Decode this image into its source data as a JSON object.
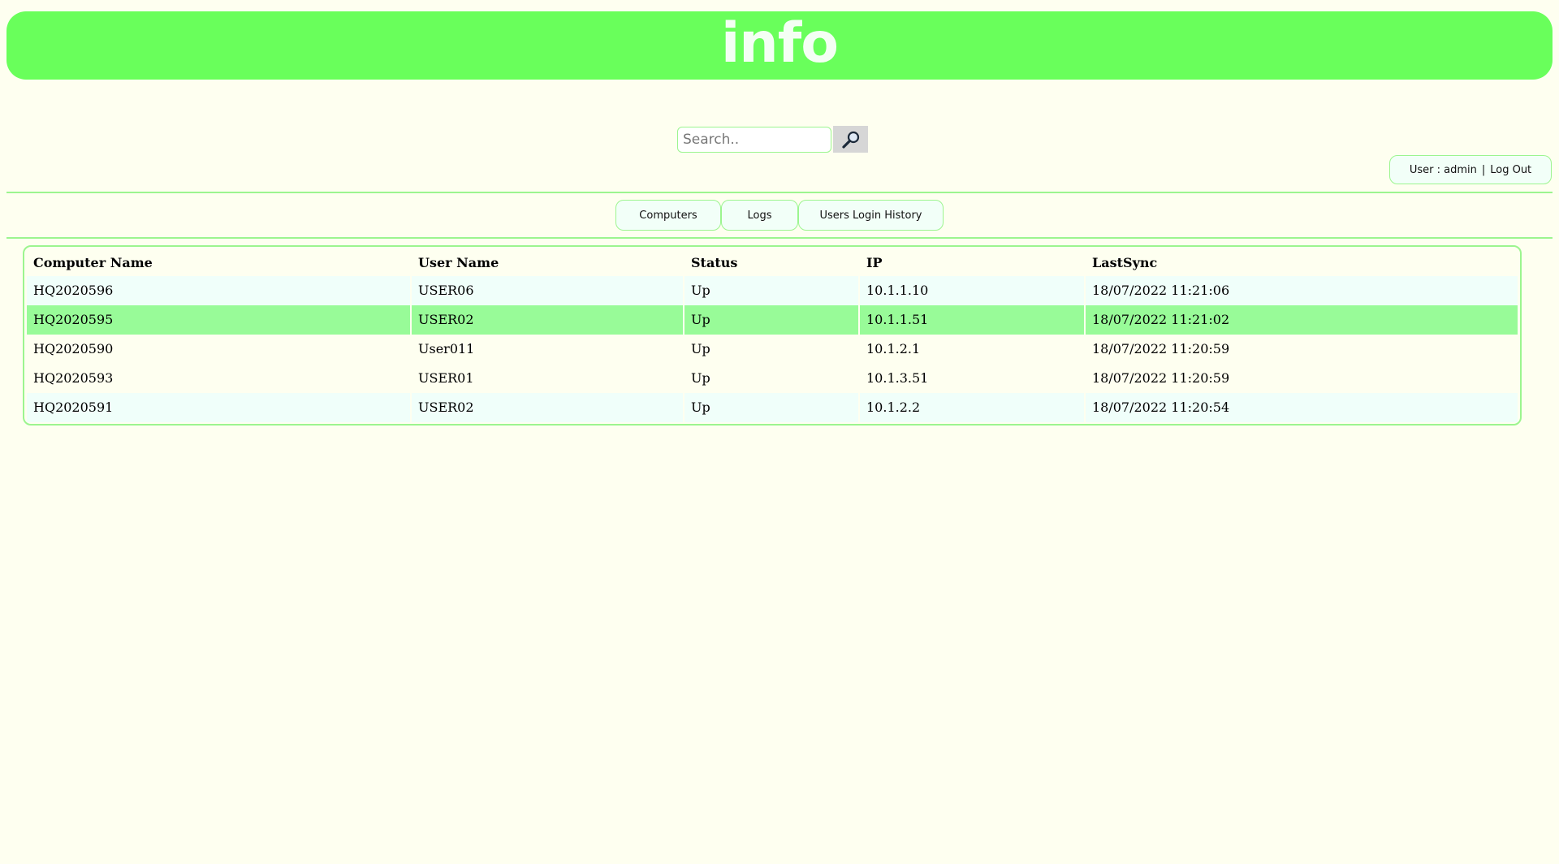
{
  "header": {
    "logo_text": "info"
  },
  "search": {
    "placeholder": "Search..",
    "button_icon": "magnifier-icon"
  },
  "user": {
    "label": "User : admin",
    "separator": "|",
    "logout": "Log Out"
  },
  "nav": {
    "tabs": [
      {
        "label": "Computers"
      },
      {
        "label": "Logs"
      },
      {
        "label": "Users Login History"
      }
    ]
  },
  "table": {
    "columns": [
      "Computer Name",
      "User Name",
      "Status",
      "IP",
      "LastSync"
    ],
    "selected_row": 1,
    "rows": [
      [
        "HQ2020596",
        "USER06",
        "Up",
        "10.1.1.10",
        "18/07/2022 11:21:06"
      ],
      [
        "HQ2020595",
        "USER02",
        "Up",
        "10.1.1.51",
        "18/07/2022 11:21:02"
      ],
      [
        "HQ2020590",
        "User011",
        "Up",
        "10.1.2.1",
        "18/07/2022 11:20:59"
      ],
      [
        "HQ2020593",
        "USER01",
        "Up",
        "10.1.3.51",
        "18/07/2022 11:20:59"
      ],
      [
        "HQ2020591",
        "USER02",
        "Up",
        "10.1.2.2",
        "18/07/2022 11:20:54"
      ]
    ]
  },
  "colors": {
    "header_bg": "#69ff5b",
    "page_bg": "#fefff0",
    "accent_border": "#9cf58f",
    "row_highlight": "#98fb98",
    "row_alt": "#f0fffa"
  }
}
